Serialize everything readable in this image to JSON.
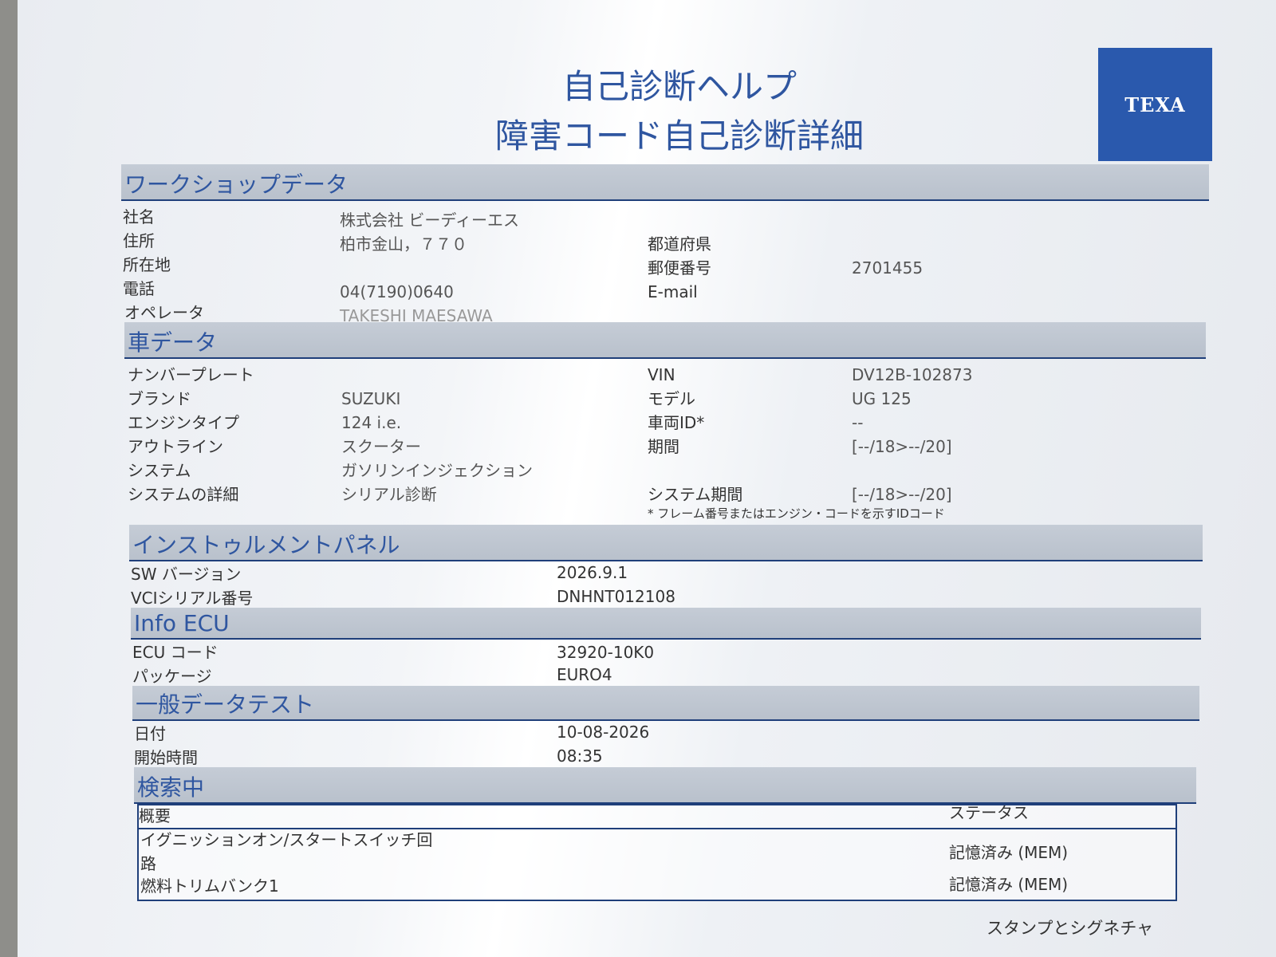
{
  "logo": "TEXA",
  "title_line1": "自己診断ヘルプ",
  "title_line2": "障害コード自己診断詳細",
  "workshop": {
    "heading": "ワークショップデータ",
    "company_label": "社名",
    "company_value": "株式会社 ビーディーエス",
    "address_label": "住所",
    "address_value": "柏市金山，７７０",
    "prefecture_label": "都道府県",
    "prefecture_value": "",
    "location_label": "所在地",
    "location_value": "",
    "postal_label": "郵便番号",
    "postal_value": "2701455",
    "phone_label": "電話",
    "phone_value": "04(7190)0640",
    "email_label": "E-mail",
    "email_value": "",
    "operator_label": "オペレータ",
    "operator_value": "TAKESHI MAESAWA"
  },
  "vehicle": {
    "heading": "車データ",
    "plate_label": "ナンバープレート",
    "plate_value": "",
    "vin_label": "VIN",
    "vin_value": "DV12B-102873",
    "brand_label": "ブランド",
    "brand_value": "SUZUKI",
    "model_label": "モデル",
    "model_value": "UG 125",
    "engine_label": "エンジンタイプ",
    "engine_value": "124 i.e.",
    "vehicle_id_label": "車両ID*",
    "vehicle_id_value": "--",
    "outline_label": "アウトライン",
    "outline_value": "スクーター",
    "period_label": "期間",
    "period_value": "[--/18>--/20]",
    "system_label": "システム",
    "system_value": "ガソリンインジェクション",
    "system_detail_label": "システムの詳細",
    "system_detail_value": "シリアル診断",
    "system_period_label": "システム期間",
    "system_period_value": "[--/18>--/20]",
    "footnote": "* フレーム番号またはエンジン・コードを示すIDコード"
  },
  "instrument": {
    "heading": "インストゥルメントパネル",
    "sw_label": "SW バージョン",
    "sw_value": "2026.9.1",
    "vci_label": "VCIシリアル番号",
    "vci_value": "DNHNT012108"
  },
  "ecu": {
    "heading": "Info ECU",
    "code_label": "ECU コード",
    "code_value": "32920-10K0",
    "package_label": "パッケージ",
    "package_value": "EURO4"
  },
  "general": {
    "heading": "一般データテスト",
    "date_label": "日付",
    "date_value": "10-08-2026",
    "start_label": "開始時間",
    "start_value": "08:35"
  },
  "search": {
    "heading": "検索中",
    "col_summary": "概要",
    "col_status": "ステータス",
    "rows": [
      {
        "summary_line1": "イグニッションオン/スタートスイッチ回",
        "summary_line2": "路",
        "status": "記憶済み (MEM)"
      },
      {
        "summary_line1": "燃料トリムバンク1",
        "summary_line2": "",
        "status": "記憶済み (MEM)"
      }
    ]
  },
  "stamp_label": "スタンプとシグネチャ",
  "colors": {
    "accent_blue": "#2f56a0",
    "logo_blue": "#2a59ad",
    "section_gray": "#c1c8d2"
  }
}
